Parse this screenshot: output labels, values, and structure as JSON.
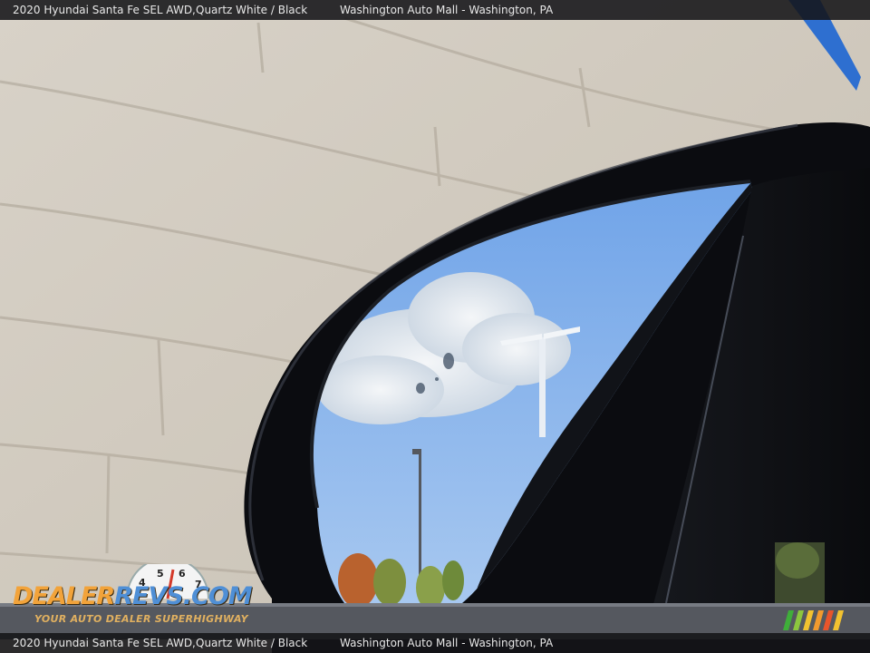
{
  "caption": {
    "vehicle": "2020 Hyundai Santa Fe SEL AWD,",
    "colors": "Quartz White / Black",
    "dealer": "Washington Auto Mall - Washington, PA"
  },
  "watermark": {
    "brand_part1": "DEALER",
    "brand_part2": "REVS",
    "brand_part3": ".COM",
    "tagline": "YOUR AUTO DEALER SUPERHIGHWAY",
    "speedo_digits": [
      "4",
      "5",
      "6",
      "7"
    ]
  },
  "colors": {
    "wall": "#cfc8bd",
    "sky": "#7fb0ec",
    "mirror_housing": "#0b0c10",
    "brand_orange": "#f2a33a",
    "brand_blue": "#4f8fd6"
  }
}
